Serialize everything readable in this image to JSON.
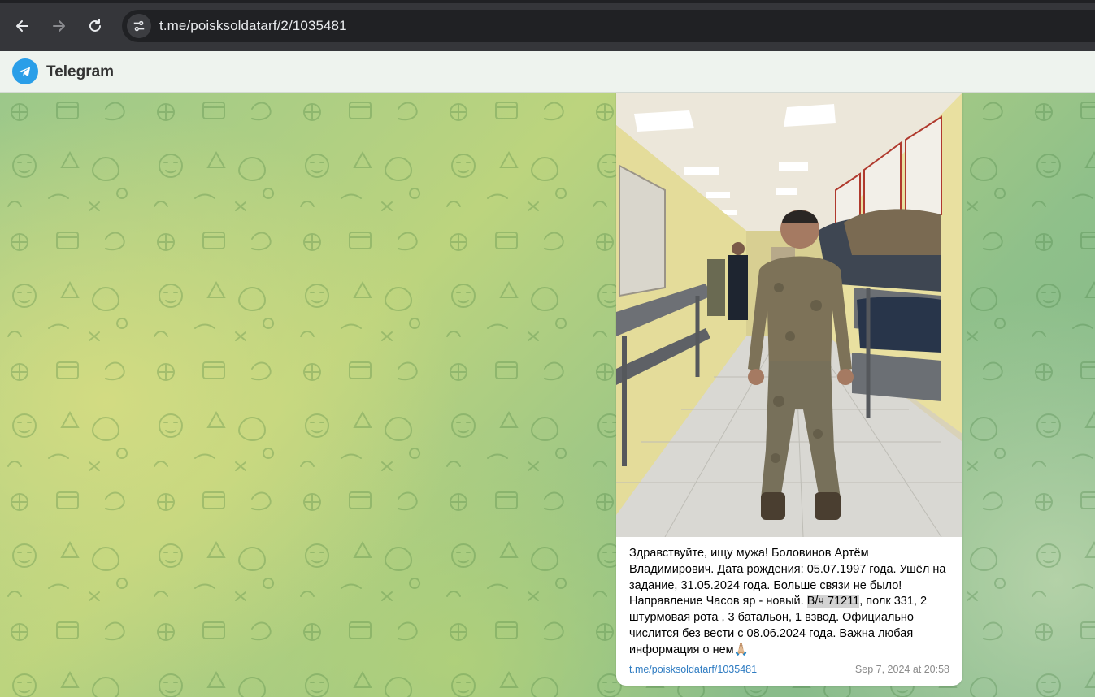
{
  "browser": {
    "url": "t.me/poisksoldatarf/2/1035481",
    "back_icon": "back-arrow-icon",
    "forward_icon": "forward-arrow-icon",
    "reload_icon": "reload-icon",
    "site_info_icon": "tune-icon"
  },
  "header": {
    "title": "Telegram",
    "logo_icon": "telegram-logo-icon",
    "accent": "#2a9ee8"
  },
  "message": {
    "text_before": "Здравствуйте, ищу мужа! Боловинов Артём Владимирович. Дата рождения: 05.07.1997 года. Ушёл на задание, 31.05.2024 года. Больше связи не было! Направление Часов яр - новый. ",
    "text_highlight": "В/ч 71211",
    "text_after": ", полк 331, 2 штурмовая рота , 3 батальон, 1 взвод. Официально числится без вести с 08.06.2024 года. Важна любая информация о нем🙏🏼",
    "link": "t.me/poisksoldatarf/1035481",
    "date": "Sep 7, 2024 at 20:58",
    "link_color": "#2f7cc2"
  }
}
